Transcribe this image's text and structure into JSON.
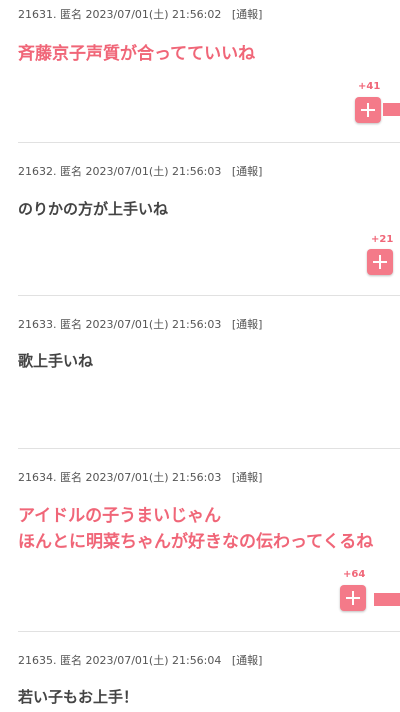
{
  "comments": [
    {
      "id": "21631.",
      "author": "匿名",
      "date": "2023/07/01(土)",
      "time": "21:56:02",
      "report_label": "[通報]",
      "lines": [
        "斉藤京子声質が合ってていいね"
      ],
      "plus_count": "+41",
      "vote_fraction": 0.64
    },
    {
      "id": "21632.",
      "author": "匿名",
      "date": "2023/07/01(土)",
      "time": "21:56:03",
      "report_label": "[通報]",
      "lines": [
        "のりかの方が上手いね"
      ],
      "plus_count": "+21",
      "vote_fraction": 0.0
    },
    {
      "id": "21633.",
      "author": "匿名",
      "date": "2023/07/01(土)",
      "time": "21:56:03",
      "report_label": "[通報]",
      "lines": [
        "歌上手いね"
      ]
    },
    {
      "id": "21634.",
      "author": "匿名",
      "date": "2023/07/01(土)",
      "time": "21:56:03",
      "report_label": "[通報]",
      "lines": [
        "アイドルの子うまいじゃん",
        "ほんとに明菜ちゃんが好きなの伝わってくるね"
      ],
      "plus_count": "+64",
      "vote_fraction": 1.0
    },
    {
      "id": "21635.",
      "author": "匿名",
      "date": "2023/07/01(土)",
      "time": "21:56:04",
      "report_label": "[通報]",
      "lines": [
        "若い子もお上手！"
      ]
    }
  ],
  "colors": {
    "hot_text": "#f06678",
    "plus_button": "#f47a89",
    "divider": "#e1e1e1"
  },
  "icons": {
    "plus": "plus-icon"
  }
}
